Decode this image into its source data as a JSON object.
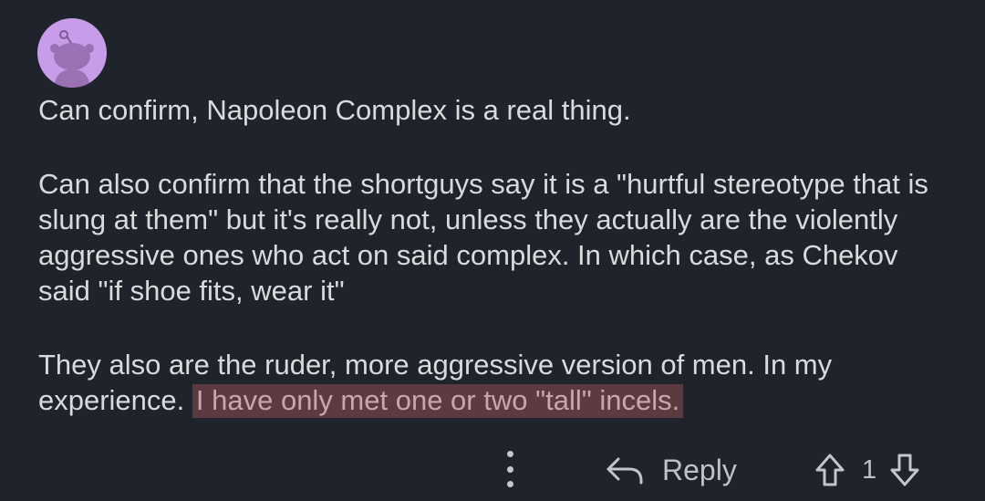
{
  "comment": {
    "avatar_icon": "snoo-avatar",
    "paragraphs": [
      "Can confirm, Napoleon Complex is a real thing.",
      "Can also confirm that the shortguys say it is a \"hurtful stereotype that is slung at them\" but it's really not, unless they actually are the violently aggressive ones who act on said complex. In which case, as Chekov said \"if shoe fits, wear it\""
    ],
    "paragraph3_plain": "They also are the ruder, more aggressive version of men. In my experience. ",
    "paragraph3_highlight": "I have only met one or two \"tall\" incels."
  },
  "actions": {
    "more_icon": "more-vertical-icon",
    "reply_icon": "reply-arrow-icon",
    "reply_label": "Reply",
    "upvote_icon": "upvote-arrow-icon",
    "vote_count": "1",
    "downvote_icon": "downvote-arrow-icon"
  },
  "colors": {
    "background": "#1f232b",
    "text": "#d9dadc",
    "highlight_bg": "#5b3a41",
    "highlight_text": "#c9a6ad",
    "avatar_bg": "#c79ce8"
  }
}
